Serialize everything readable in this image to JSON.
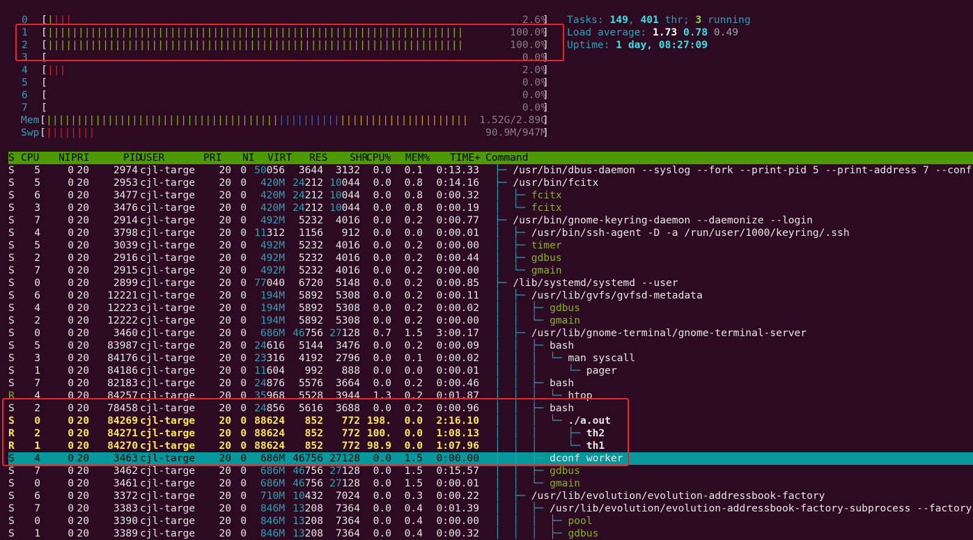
{
  "cpus": [
    {
      "id": "0",
      "pct": "2.6%",
      "bars": [
        {
          "c": "green",
          "n": 1
        },
        {
          "c": "red",
          "n": 3
        }
      ]
    },
    {
      "id": "1",
      "pct": "100.0%",
      "bars": [
        {
          "c": "green",
          "n": 68
        }
      ]
    },
    {
      "id": "2",
      "pct": "100.0%",
      "bars": [
        {
          "c": "green",
          "n": 68
        }
      ]
    },
    {
      "id": "3",
      "pct": "0.0%",
      "bars": []
    },
    {
      "id": "4",
      "pct": "2.0%",
      "bars": [
        {
          "c": "red",
          "n": 3
        }
      ]
    },
    {
      "id": "5",
      "pct": "0.0%",
      "bars": []
    },
    {
      "id": "6",
      "pct": "0.0%",
      "bars": []
    },
    {
      "id": "7",
      "pct": "0.0%",
      "bars": []
    }
  ],
  "mem": {
    "label": "Mem",
    "value": "1.52G/2.89G",
    "bars": [
      {
        "c": "green",
        "n": 38
      },
      {
        "c": "blue",
        "n": 10
      },
      {
        "c": "yellow",
        "n": 21
      }
    ]
  },
  "swp": {
    "label": "Swp",
    "value": "90.9M/947M",
    "bars": [
      {
        "c": "red",
        "n": 8
      }
    ]
  },
  "summary": {
    "tasks_label": "Tasks: ",
    "tasks": "149",
    "sep1": ", ",
    "thr": "401",
    "thr_label": " thr; ",
    "running": "3",
    "running_label": " running",
    "load_label": "Load average: ",
    "load1": "1.73",
    "load5": "0.78",
    "load15": "0.49",
    "uptime_label": "Uptime: ",
    "uptime": "1 day, 08:27:09"
  },
  "columns": [
    "S",
    "CPU",
    "NI",
    "PRI",
    "PID",
    "USER",
    "PRI",
    "NI",
    "VIRT",
    "RES",
    "SHR",
    "CPU%",
    "MEM%",
    "TIME+",
    "Command"
  ],
  "processes": [
    {
      "s": "S",
      "cpu": "5",
      "ni": "0",
      "pri": "20",
      "pid": "2974",
      "user": "cjl-targe",
      "pri2": "20",
      "ni2": "0",
      "virt": "50056",
      "res": "3644",
      "shr": "3132",
      "cpup": "0.0",
      "memp": "0.1",
      "time": "0:13.33",
      "tree": "├─ ",
      "cmd": "/usr/bin/dbus-daemon --syslog --fork --print-pid 5 --print-address 7 --conf",
      "cmdc": "white"
    },
    {
      "s": "S",
      "cpu": "5",
      "ni": "0",
      "pri": "20",
      "pid": "2953",
      "user": "cjl-targe",
      "pri2": "20",
      "ni2": "0",
      "virt": "420M",
      "res": "24212",
      "shr": "10044",
      "cpup": "0.0",
      "memp": "0.8",
      "time": "0:14.16",
      "tree": "├─ ",
      "cmd": "/usr/bin/fcitx",
      "cmdc": "white"
    },
    {
      "s": "S",
      "cpu": "6",
      "ni": "0",
      "pri": "20",
      "pid": "3477",
      "user": "cjl-targe",
      "pri2": "20",
      "ni2": "0",
      "virt": "420M",
      "res": "24212",
      "shr": "10044",
      "cpup": "0.0",
      "memp": "0.8",
      "time": "0:00.32",
      "tree": "│  ├─ ",
      "cmd": "fcitx",
      "cmdc": "green"
    },
    {
      "s": "S",
      "cpu": "3",
      "ni": "0",
      "pri": "20",
      "pid": "3476",
      "user": "cjl-targe",
      "pri2": "20",
      "ni2": "0",
      "virt": "420M",
      "res": "24212",
      "shr": "10044",
      "cpup": "0.0",
      "memp": "0.8",
      "time": "0:00.19",
      "tree": "│  └─ ",
      "cmd": "fcitx",
      "cmdc": "green"
    },
    {
      "s": "S",
      "cpu": "7",
      "ni": "0",
      "pri": "20",
      "pid": "2914",
      "user": "cjl-targe",
      "pri2": "20",
      "ni2": "0",
      "virt": "492M",
      "res": "5232",
      "shr": "4016",
      "cpup": "0.0",
      "memp": "0.2",
      "time": "0:00.77",
      "tree": "├─ ",
      "cmd": "/usr/bin/gnome-keyring-daemon --daemonize --login",
      "cmdc": "white"
    },
    {
      "s": "S",
      "cpu": "4",
      "ni": "0",
      "pri": "20",
      "pid": "3798",
      "user": "cjl-targe",
      "pri2": "20",
      "ni2": "0",
      "virt": "11312",
      "res": "1156",
      "shr": "912",
      "cpup": "0.0",
      "memp": "0.0",
      "time": "0:00.01",
      "tree": "│  ├─ ",
      "cmd": "/usr/bin/ssh-agent -D -a /run/user/1000/keyring/.ssh",
      "cmdc": "white"
    },
    {
      "s": "S",
      "cpu": "5",
      "ni": "0",
      "pri": "20",
      "pid": "3039",
      "user": "cjl-targe",
      "pri2": "20",
      "ni2": "0",
      "virt": "492M",
      "res": "5232",
      "shr": "4016",
      "cpup": "0.0",
      "memp": "0.2",
      "time": "0:00.00",
      "tree": "│  ├─ ",
      "cmd": "timer",
      "cmdc": "green"
    },
    {
      "s": "S",
      "cpu": "2",
      "ni": "0",
      "pri": "20",
      "pid": "2916",
      "user": "cjl-targe",
      "pri2": "20",
      "ni2": "0",
      "virt": "492M",
      "res": "5232",
      "shr": "4016",
      "cpup": "0.0",
      "memp": "0.2",
      "time": "0:00.44",
      "tree": "│  ├─ ",
      "cmd": "gdbus",
      "cmdc": "green"
    },
    {
      "s": "S",
      "cpu": "7",
      "ni": "0",
      "pri": "20",
      "pid": "2915",
      "user": "cjl-targe",
      "pri2": "20",
      "ni2": "0",
      "virt": "492M",
      "res": "5232",
      "shr": "4016",
      "cpup": "0.0",
      "memp": "0.2",
      "time": "0:00.00",
      "tree": "│  └─ ",
      "cmd": "gmain",
      "cmdc": "green"
    },
    {
      "s": "S",
      "cpu": "0",
      "ni": "0",
      "pri": "20",
      "pid": "2899",
      "user": "cjl-targe",
      "pri2": "20",
      "ni2": "0",
      "virt": "77040",
      "res": "6720",
      "shr": "5148",
      "cpup": "0.0",
      "memp": "0.2",
      "time": "0:00.85",
      "tree": "├─ ",
      "cmd": "/lib/systemd/systemd --user",
      "cmdc": "white"
    },
    {
      "s": "S",
      "cpu": "6",
      "ni": "0",
      "pri": "20",
      "pid": "12221",
      "user": "cjl-targe",
      "pri2": "20",
      "ni2": "0",
      "virt": "194M",
      "res": "5892",
      "shr": "5308",
      "cpup": "0.0",
      "memp": "0.2",
      "time": "0:00.11",
      "tree": "│  ├─ ",
      "cmd": "/usr/lib/gvfs/gvfsd-metadata",
      "cmdc": "white"
    },
    {
      "s": "S",
      "cpu": "4",
      "ni": "0",
      "pri": "20",
      "pid": "12223",
      "user": "cjl-targe",
      "pri2": "20",
      "ni2": "0",
      "virt": "194M",
      "res": "5892",
      "shr": "5308",
      "cpup": "0.0",
      "memp": "0.2",
      "time": "0:00.02",
      "tree": "│  │  ├─ ",
      "cmd": "gdbus",
      "cmdc": "green"
    },
    {
      "s": "S",
      "cpu": "2",
      "ni": "0",
      "pri": "20",
      "pid": "12222",
      "user": "cjl-targe",
      "pri2": "20",
      "ni2": "0",
      "virt": "194M",
      "res": "5892",
      "shr": "5308",
      "cpup": "0.0",
      "memp": "0.2",
      "time": "0:00.00",
      "tree": "│  │  └─ ",
      "cmd": "gmain",
      "cmdc": "green"
    },
    {
      "s": "S",
      "cpu": "0",
      "ni": "0",
      "pri": "20",
      "pid": "3460",
      "user": "cjl-targe",
      "pri2": "20",
      "ni2": "0",
      "virt": "686M",
      "res": "46756",
      "shr": "27128",
      "cpup": "0.7",
      "memp": "1.5",
      "time": "3:00.17",
      "tree": "│  ├─ ",
      "cmd": "/usr/lib/gnome-terminal/gnome-terminal-server",
      "cmdc": "white"
    },
    {
      "s": "S",
      "cpu": "5",
      "ni": "0",
      "pri": "20",
      "pid": "83987",
      "user": "cjl-targe",
      "pri2": "20",
      "ni2": "0",
      "virt": "24616",
      "res": "5144",
      "shr": "3476",
      "cpup": "0.0",
      "memp": "0.2",
      "time": "0:00.09",
      "tree": "│  │  ├─ ",
      "cmd": "bash",
      "cmdc": "white"
    },
    {
      "s": "S",
      "cpu": "3",
      "ni": "0",
      "pri": "20",
      "pid": "84176",
      "user": "cjl-targe",
      "pri2": "20",
      "ni2": "0",
      "virt": "23316",
      "res": "4192",
      "shr": "2796",
      "cpup": "0.0",
      "memp": "0.1",
      "time": "0:00.02",
      "tree": "│  │  │  └─ ",
      "cmd": "man syscall",
      "cmdc": "white"
    },
    {
      "s": "S",
      "cpu": "1",
      "ni": "0",
      "pri": "20",
      "pid": "84186",
      "user": "cjl-targe",
      "pri2": "20",
      "ni2": "0",
      "virt": "11604",
      "res": "992",
      "shr": "888",
      "cpup": "0.0",
      "memp": "0.0",
      "time": "0:00.01",
      "tree": "│  │  │     └─ ",
      "cmd": "pager",
      "cmdc": "white"
    },
    {
      "s": "S",
      "cpu": "7",
      "ni": "0",
      "pri": "20",
      "pid": "82183",
      "user": "cjl-targe",
      "pri2": "20",
      "ni2": "0",
      "virt": "24876",
      "res": "5576",
      "shr": "3664",
      "cpup": "0.0",
      "memp": "0.2",
      "time": "0:00.46",
      "tree": "│  │  ├─ ",
      "cmd": "bash",
      "cmdc": "white"
    },
    {
      "s": "R",
      "cpu": "4",
      "ni": "0",
      "pri": "20",
      "pid": "84257",
      "user": "cjl-targe",
      "pri2": "20",
      "ni2": "0",
      "virt": "35968",
      "res": "5528",
      "shr": "3944",
      "cpup": "1.3",
      "memp": "0.2",
      "time": "0:01.87",
      "tree": "│  │  │  └─ ",
      "cmd": "htop",
      "cmdc": "white"
    },
    {
      "s": "S",
      "cpu": "2",
      "ni": "0",
      "pri": "20",
      "pid": "78458",
      "user": "cjl-targe",
      "pri2": "20",
      "ni2": "0",
      "virt": "24856",
      "res": "5616",
      "shr": "3688",
      "cpup": "0.0",
      "memp": "0.2",
      "time": "0:00.96",
      "tree": "│  │  ├─ ",
      "cmd": "bash",
      "cmdc": "white"
    },
    {
      "s": "S",
      "cpu": "0",
      "ni": "0",
      "pri": "20",
      "pid": "84269",
      "user": "cjl-targe",
      "pri2": "20",
      "ni2": "0",
      "virt": "88624",
      "res": "852",
      "shr": "772",
      "cpup": "198.",
      "memp": "0.0",
      "time": "2:16.10",
      "tree": "│  │  │  └─ ",
      "cmd": "./a.out",
      "cmdc": "white",
      "bold": true
    },
    {
      "s": "R",
      "cpu": "2",
      "ni": "0",
      "pri": "20",
      "pid": "84271",
      "user": "cjl-targe",
      "pri2": "20",
      "ni2": "0",
      "virt": "88624",
      "res": "852",
      "shr": "772",
      "cpup": "100.",
      "memp": "0.0",
      "time": "1:08.13",
      "tree": "│  │  │     ├─ ",
      "cmd": "th2",
      "cmdc": "white",
      "bold": true
    },
    {
      "s": "R",
      "cpu": "1",
      "ni": "0",
      "pri": "20",
      "pid": "84270",
      "user": "cjl-targe",
      "pri2": "20",
      "ni2": "0",
      "virt": "88624",
      "res": "852",
      "shr": "772",
      "cpup": "98.9",
      "memp": "0.0",
      "time": "1:07.96",
      "tree": "│  │  │     └─ ",
      "cmd": "th1",
      "cmdc": "white",
      "bold": true
    },
    {
      "s": "S",
      "cpu": "4",
      "ni": "0",
      "pri": "20",
      "pid": "3463",
      "user": "cjl-targe",
      "pri2": "20",
      "ni2": "0",
      "virt": "686M",
      "res": "46756",
      "shr": "27128",
      "cpup": "0.0",
      "memp": "1.5",
      "time": "0:00.00",
      "tree": "│  │  ├─ ",
      "cmd": "dconf worker",
      "cmdc": "white",
      "selected": true
    },
    {
      "s": "S",
      "cpu": "7",
      "ni": "0",
      "pri": "20",
      "pid": "3462",
      "user": "cjl-targe",
      "pri2": "20",
      "ni2": "0",
      "virt": "686M",
      "res": "46756",
      "shr": "27128",
      "cpup": "0.0",
      "memp": "1.5",
      "time": "0:15.57",
      "tree": "│  │  ├─ ",
      "cmd": "gdbus",
      "cmdc": "green"
    },
    {
      "s": "S",
      "cpu": "0",
      "ni": "0",
      "pri": "20",
      "pid": "3461",
      "user": "cjl-targe",
      "pri2": "20",
      "ni2": "0",
      "virt": "686M",
      "res": "46756",
      "shr": "27128",
      "cpup": "0.0",
      "memp": "1.5",
      "time": "0:00.01",
      "tree": "│  │  └─ ",
      "cmd": "gmain",
      "cmdc": "green"
    },
    {
      "s": "S",
      "cpu": "6",
      "ni": "0",
      "pri": "20",
      "pid": "3372",
      "user": "cjl-targe",
      "pri2": "20",
      "ni2": "0",
      "virt": "710M",
      "res": "10432",
      "shr": "7024",
      "cpup": "0.0",
      "memp": "0.3",
      "time": "0:00.22",
      "tree": "│  ├─ ",
      "cmd": "/usr/lib/evolution/evolution-addressbook-factory",
      "cmdc": "white"
    },
    {
      "s": "S",
      "cpu": "7",
      "ni": "0",
      "pri": "20",
      "pid": "3383",
      "user": "cjl-targe",
      "pri2": "20",
      "ni2": "0",
      "virt": "846M",
      "res": "13208",
      "shr": "7364",
      "cpup": "0.0",
      "memp": "0.4",
      "time": "0:01.39",
      "tree": "│  │  ├─ ",
      "cmd": "/usr/lib/evolution/evolution-addressbook-factory-subprocess --factory",
      "cmdc": "white"
    },
    {
      "s": "S",
      "cpu": "0",
      "ni": "0",
      "pri": "20",
      "pid": "3390",
      "user": "cjl-targe",
      "pri2": "20",
      "ni2": "0",
      "virt": "846M",
      "res": "13208",
      "shr": "7364",
      "cpup": "0.0",
      "memp": "0.4",
      "time": "0:00.00",
      "tree": "│  │  │  ├─ ",
      "cmd": "pool",
      "cmdc": "green"
    },
    {
      "s": "S",
      "cpu": "1",
      "ni": "0",
      "pri": "20",
      "pid": "3389",
      "user": "cjl-targe",
      "pri2": "20",
      "ni2": "0",
      "virt": "846M",
      "res": "13208",
      "shr": "7364",
      "cpup": "0.0",
      "memp": "0.4",
      "time": "0:00.32",
      "tree": "│  │  │  ├─ ",
      "cmd": "gdbus",
      "cmdc": "green"
    }
  ]
}
